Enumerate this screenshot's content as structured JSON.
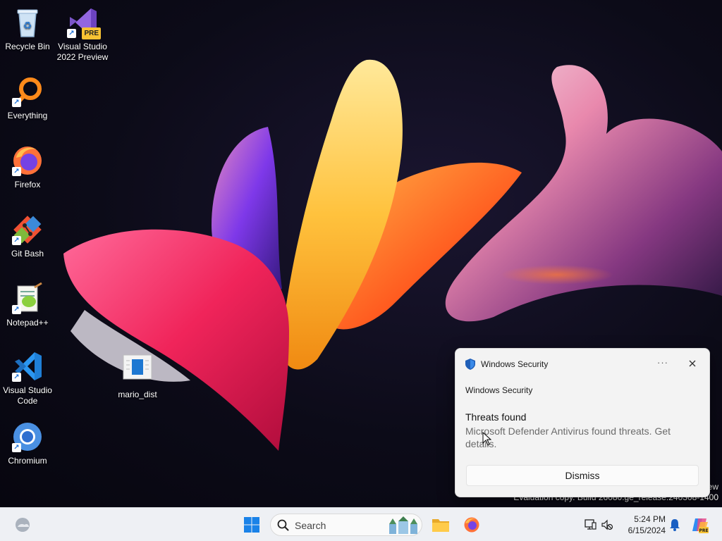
{
  "desktop": {
    "icons": [
      {
        "label": "Recycle Bin",
        "icon": "recycle-bin-icon"
      },
      {
        "label": "Visual Studio 2022 Preview",
        "line1": "Visual Studio",
        "line2": "2022 Preview",
        "icon": "visual-studio-preview-icon",
        "badge": "PRE"
      },
      {
        "label": "Everything",
        "icon": "everything-search-icon"
      },
      {
        "label": "Firefox",
        "icon": "firefox-icon"
      },
      {
        "label": "Git Bash",
        "icon": "git-bash-icon"
      },
      {
        "label": "Notepad++",
        "icon": "notepad-plus-plus-icon"
      },
      {
        "label": "Visual Studio Code",
        "line1": "Visual Studio",
        "line2": "Code",
        "icon": "vscode-icon"
      },
      {
        "label": "Chromium",
        "icon": "chromium-icon"
      },
      {
        "label": "mario_dist",
        "icon": "file-icon"
      }
    ]
  },
  "watermark": {
    "line1": "ew",
    "line2": "Evaluation copy. Build 26080.ge_release.240308-1400"
  },
  "toast": {
    "app_name": "Windows Security",
    "subtitle": "Windows Security",
    "title": "Threats found",
    "body": "Microsoft Defender Antivirus found threats. Get details.",
    "more_label": "···",
    "dismiss_label": "Dismiss"
  },
  "taskbar": {
    "search_placeholder": "Search",
    "time": "5:24 PM",
    "date": "6/15/2024"
  },
  "colors": {
    "accent": "#0067c0",
    "taskbar_bg": "#eef0f4",
    "toast_bg": "#f3f3f3"
  }
}
